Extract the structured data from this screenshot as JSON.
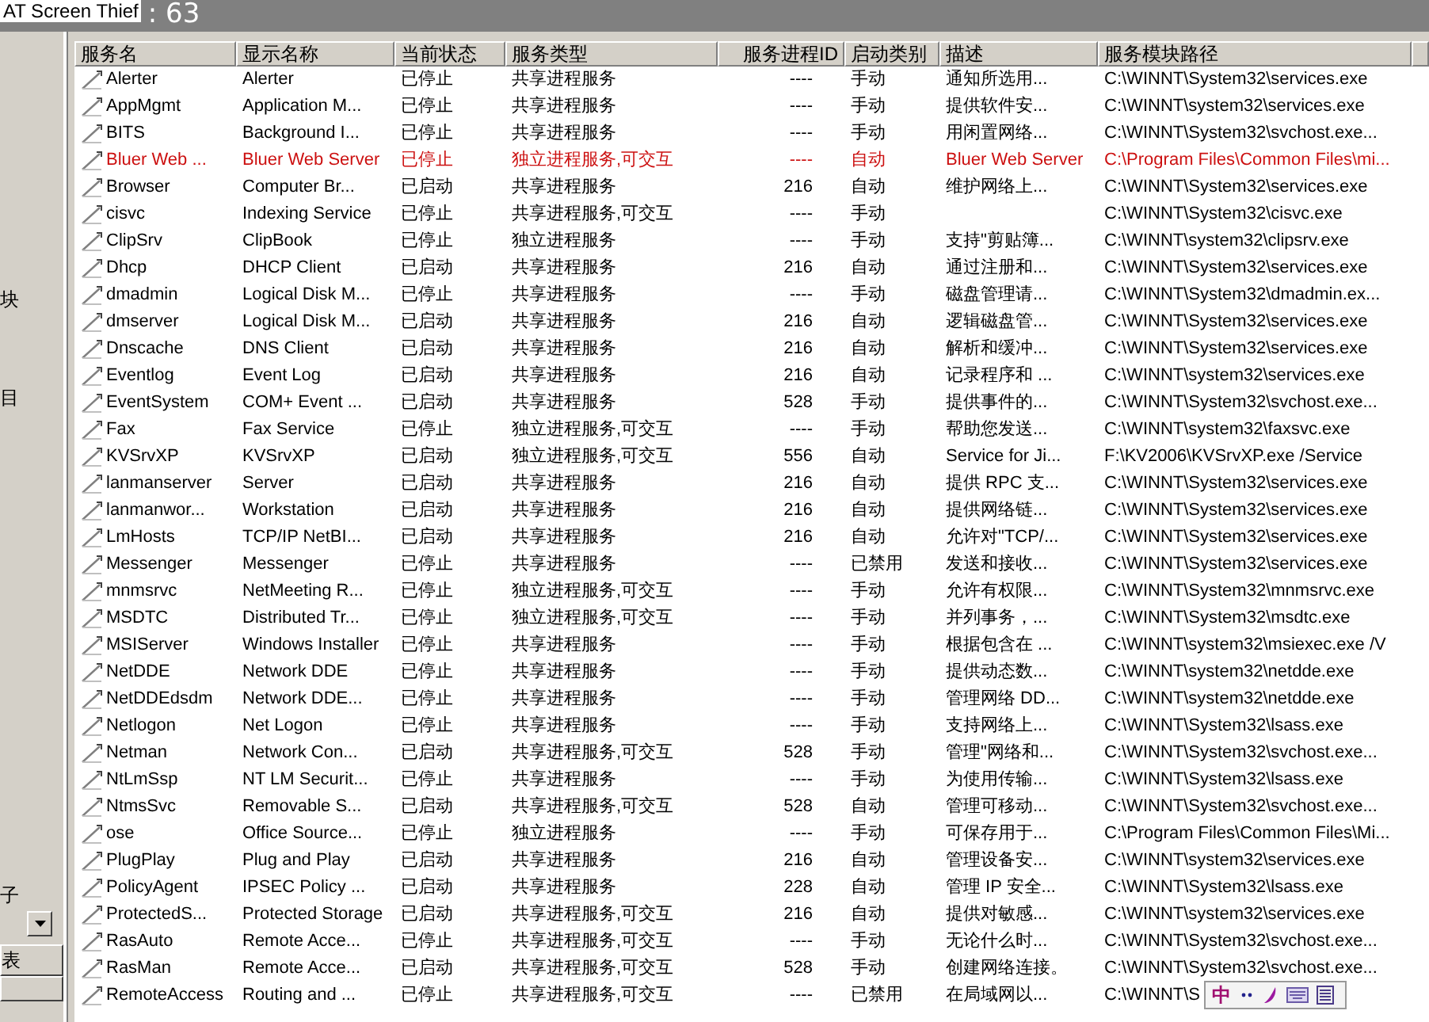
{
  "overlay_label": "AT Screen Thief",
  "count": ": 63",
  "left_panel": {
    "labels": [
      "块",
      "目",
      "子"
    ],
    "button": "表"
  },
  "table": {
    "columns": [
      "服务名",
      "显示名称",
      "当前状态",
      "服务类型",
      "服务进程ID",
      "启动类别",
      "描述",
      "服务模块路径"
    ],
    "rows": [
      {
        "name": "Alerter",
        "display": "Alerter",
        "status": "已停止",
        "type": "共享进程服务",
        "pid": "----",
        "startup": "手动",
        "desc": "通知所选用...",
        "path": "C:\\WINNT\\System32\\services.exe",
        "flagged": false
      },
      {
        "name": "AppMgmt",
        "display": "Application M...",
        "status": "已停止",
        "type": "共享进程服务",
        "pid": "----",
        "startup": "手动",
        "desc": "提供软件安...",
        "path": "C:\\WINNT\\system32\\services.exe",
        "flagged": false
      },
      {
        "name": "BITS",
        "display": "Background I...",
        "status": "已停止",
        "type": "共享进程服务",
        "pid": "----",
        "startup": "手动",
        "desc": "用闲置网络...",
        "path": "C:\\WINNT\\System32\\svchost.exe...",
        "flagged": false
      },
      {
        "name": "Bluer Web ...",
        "display": "Bluer Web Server",
        "status": "已停止",
        "type": "独立进程服务,可交互",
        "pid": "----",
        "startup": "自动",
        "desc": "Bluer Web Server",
        "path": "C:\\Program Files\\Common Files\\mi...",
        "flagged": true
      },
      {
        "name": "Browser",
        "display": "Computer Br...",
        "status": "已启动",
        "type": "共享进程服务",
        "pid": "216",
        "startup": "自动",
        "desc": "维护网络上...",
        "path": "C:\\WINNT\\System32\\services.exe",
        "flagged": false
      },
      {
        "name": "cisvc",
        "display": "Indexing Service",
        "status": "已停止",
        "type": "共享进程服务,可交互",
        "pid": "----",
        "startup": "手动",
        "desc": "",
        "path": "C:\\WINNT\\System32\\cisvc.exe",
        "flagged": false
      },
      {
        "name": "ClipSrv",
        "display": "ClipBook",
        "status": "已停止",
        "type": "独立进程服务",
        "pid": "----",
        "startup": "手动",
        "desc": "支持\"剪贴簿...",
        "path": "C:\\WINNT\\system32\\clipsrv.exe",
        "flagged": false
      },
      {
        "name": "Dhcp",
        "display": "DHCP Client",
        "status": "已启动",
        "type": "共享进程服务",
        "pid": "216",
        "startup": "自动",
        "desc": "通过注册和...",
        "path": "C:\\WINNT\\System32\\services.exe",
        "flagged": false
      },
      {
        "name": "dmadmin",
        "display": "Logical Disk M...",
        "status": "已停止",
        "type": "共享进程服务",
        "pid": "----",
        "startup": "手动",
        "desc": "磁盘管理请...",
        "path": "C:\\WINNT\\System32\\dmadmin.ex...",
        "flagged": false
      },
      {
        "name": "dmserver",
        "display": "Logical Disk M...",
        "status": "已启动",
        "type": "共享进程服务",
        "pid": "216",
        "startup": "自动",
        "desc": "逻辑磁盘管...",
        "path": "C:\\WINNT\\System32\\services.exe",
        "flagged": false
      },
      {
        "name": "Dnscache",
        "display": "DNS Client",
        "status": "已启动",
        "type": "共享进程服务",
        "pid": "216",
        "startup": "自动",
        "desc": "解析和缓冲...",
        "path": "C:\\WINNT\\System32\\services.exe",
        "flagged": false
      },
      {
        "name": "Eventlog",
        "display": "Event Log",
        "status": "已启动",
        "type": "共享进程服务",
        "pid": "216",
        "startup": "自动",
        "desc": "记录程序和 ...",
        "path": "C:\\WINNT\\system32\\services.exe",
        "flagged": false
      },
      {
        "name": "EventSystem",
        "display": "COM+ Event ...",
        "status": "已启动",
        "type": "共享进程服务",
        "pid": "528",
        "startup": "手动",
        "desc": "提供事件的...",
        "path": "C:\\WINNT\\System32\\svchost.exe...",
        "flagged": false
      },
      {
        "name": "Fax",
        "display": "Fax Service",
        "status": "已停止",
        "type": "独立进程服务,可交互",
        "pid": "----",
        "startup": "手动",
        "desc": "帮助您发送...",
        "path": "C:\\WINNT\\system32\\faxsvc.exe",
        "flagged": false
      },
      {
        "name": "KVSrvXP",
        "display": "KVSrvXP",
        "status": "已启动",
        "type": "独立进程服务,可交互",
        "pid": "556",
        "startup": "自动",
        "desc": "Service for Ji...",
        "path": "F:\\KV2006\\KVSrvXP.exe /Service",
        "flagged": false
      },
      {
        "name": "lanmanserver",
        "display": "Server",
        "status": "已启动",
        "type": "共享进程服务",
        "pid": "216",
        "startup": "自动",
        "desc": "提供 RPC 支...",
        "path": "C:\\WINNT\\System32\\services.exe",
        "flagged": false
      },
      {
        "name": "lanmanwor...",
        "display": "Workstation",
        "status": "已启动",
        "type": "共享进程服务",
        "pid": "216",
        "startup": "自动",
        "desc": "提供网络链...",
        "path": "C:\\WINNT\\System32\\services.exe",
        "flagged": false
      },
      {
        "name": "LmHosts",
        "display": "TCP/IP NetBI...",
        "status": "已启动",
        "type": "共享进程服务",
        "pid": "216",
        "startup": "自动",
        "desc": "允许对\"TCP/...",
        "path": "C:\\WINNT\\System32\\services.exe",
        "flagged": false
      },
      {
        "name": "Messenger",
        "display": "Messenger",
        "status": "已停止",
        "type": "共享进程服务",
        "pid": "----",
        "startup": "已禁用",
        "desc": "发送和接收...",
        "path": "C:\\WINNT\\System32\\services.exe",
        "flagged": false
      },
      {
        "name": "mnmsrvc",
        "display": "NetMeeting R...",
        "status": "已停止",
        "type": "独立进程服务,可交互",
        "pid": "----",
        "startup": "手动",
        "desc": "允许有权限...",
        "path": "C:\\WINNT\\System32\\mnmsrvc.exe",
        "flagged": false
      },
      {
        "name": "MSDTC",
        "display": "Distributed Tr...",
        "status": "已停止",
        "type": "独立进程服务,可交互",
        "pid": "----",
        "startup": "手动",
        "desc": "并列事务，...",
        "path": "C:\\WINNT\\System32\\msdtc.exe",
        "flagged": false
      },
      {
        "name": "MSIServer",
        "display": "Windows Installer",
        "status": "已停止",
        "type": "共享进程服务",
        "pid": "----",
        "startup": "手动",
        "desc": "根据包含在 ...",
        "path": "C:\\WINNT\\system32\\msiexec.exe /V",
        "flagged": false
      },
      {
        "name": "NetDDE",
        "display": "Network DDE",
        "status": "已停止",
        "type": "共享进程服务",
        "pid": "----",
        "startup": "手动",
        "desc": "提供动态数...",
        "path": "C:\\WINNT\\system32\\netdde.exe",
        "flagged": false
      },
      {
        "name": "NetDDEdsdm",
        "display": "Network DDE...",
        "status": "已停止",
        "type": "共享进程服务",
        "pid": "----",
        "startup": "手动",
        "desc": "管理网络 DD...",
        "path": "C:\\WINNT\\system32\\netdde.exe",
        "flagged": false
      },
      {
        "name": "Netlogon",
        "display": "Net Logon",
        "status": "已停止",
        "type": "共享进程服务",
        "pid": "----",
        "startup": "手动",
        "desc": "支持网络上...",
        "path": "C:\\WINNT\\System32\\lsass.exe",
        "flagged": false
      },
      {
        "name": "Netman",
        "display": "Network Con...",
        "status": "已启动",
        "type": "共享进程服务,可交互",
        "pid": "528",
        "startup": "手动",
        "desc": "管理\"网络和...",
        "path": "C:\\WINNT\\System32\\svchost.exe...",
        "flagged": false
      },
      {
        "name": "NtLmSsp",
        "display": "NT LM Securit...",
        "status": "已停止",
        "type": "共享进程服务",
        "pid": "----",
        "startup": "手动",
        "desc": "为使用传输...",
        "path": "C:\\WINNT\\System32\\lsass.exe",
        "flagged": false
      },
      {
        "name": "NtmsSvc",
        "display": "Removable S...",
        "status": "已启动",
        "type": "共享进程服务,可交互",
        "pid": "528",
        "startup": "自动",
        "desc": "管理可移动...",
        "path": "C:\\WINNT\\System32\\svchost.exe...",
        "flagged": false
      },
      {
        "name": "ose",
        "display": "Office Source...",
        "status": "已停止",
        "type": "独立进程服务",
        "pid": "----",
        "startup": "手动",
        "desc": "可保存用于...",
        "path": "C:\\Program Files\\Common Files\\Mi...",
        "flagged": false
      },
      {
        "name": "PlugPlay",
        "display": "Plug and Play",
        "status": "已启动",
        "type": "共享进程服务",
        "pid": "216",
        "startup": "自动",
        "desc": "管理设备安...",
        "path": "C:\\WINNT\\system32\\services.exe",
        "flagged": false
      },
      {
        "name": "PolicyAgent",
        "display": "IPSEC Policy ...",
        "status": "已启动",
        "type": "共享进程服务",
        "pid": "228",
        "startup": "自动",
        "desc": "管理 IP 安全...",
        "path": "C:\\WINNT\\System32\\lsass.exe",
        "flagged": false
      },
      {
        "name": "ProtectedS...",
        "display": "Protected Storage",
        "status": "已启动",
        "type": "共享进程服务,可交互",
        "pid": "216",
        "startup": "自动",
        "desc": "提供对敏感...",
        "path": "C:\\WINNT\\system32\\services.exe",
        "flagged": false
      },
      {
        "name": "RasAuto",
        "display": "Remote Acce...",
        "status": "已停止",
        "type": "共享进程服务,可交互",
        "pid": "----",
        "startup": "手动",
        "desc": "无论什么时...",
        "path": "C:\\WINNT\\System32\\svchost.exe...",
        "flagged": false
      },
      {
        "name": "RasMan",
        "display": "Remote Acce...",
        "status": "已启动",
        "type": "共享进程服务,可交互",
        "pid": "528",
        "startup": "手动",
        "desc": "创建网络连接。",
        "path": "C:\\WINNT\\System32\\svchost.exe...",
        "flagged": false
      },
      {
        "name": "RemoteAccess",
        "display": "Routing and ...",
        "status": "已停止",
        "type": "共享进程服务,可交互",
        "pid": "----",
        "startup": "已禁用",
        "desc": "在局域网以...",
        "path": "C:\\WINNT\\S",
        "flagged": false
      }
    ]
  },
  "ime_toolbar": {
    "mode": "中"
  }
}
